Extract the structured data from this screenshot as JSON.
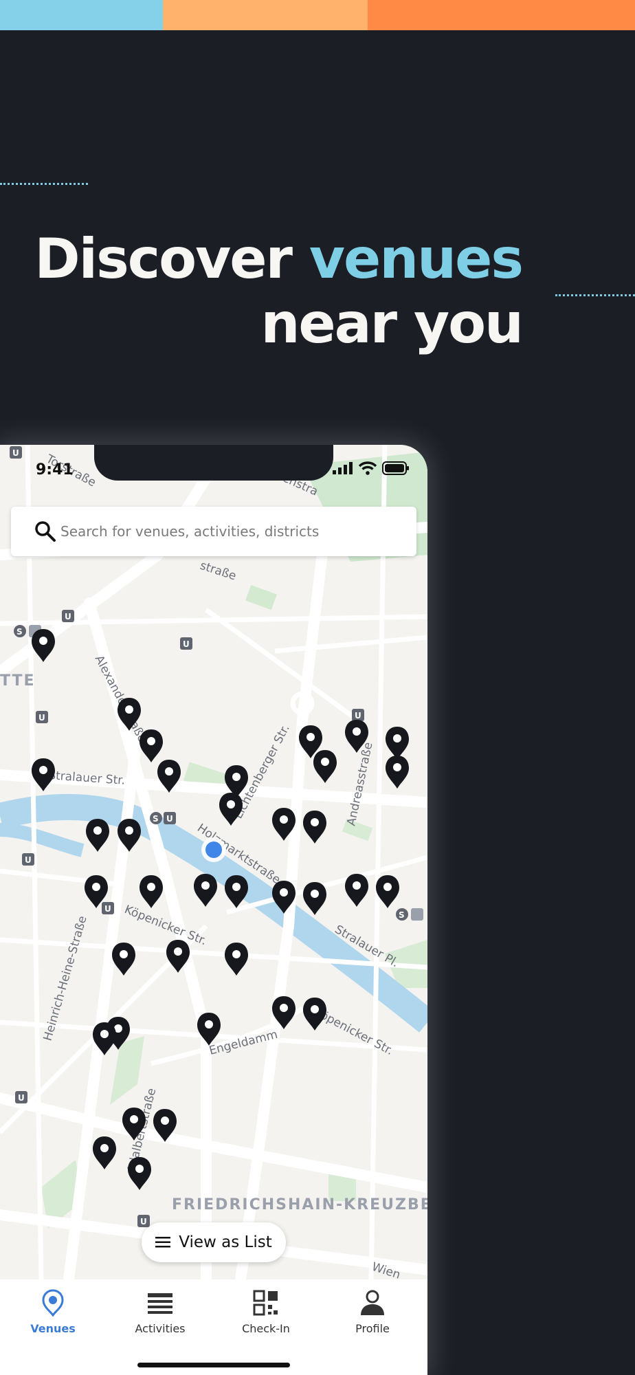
{
  "headline": {
    "line1_part1": "Discover",
    "line1_accent": "venues",
    "line2": "near you"
  },
  "colors": {
    "background": "#1b1e25",
    "accent": "#7ecfe6",
    "stripe_blue": "#86d1ea",
    "stripe_peach": "#ffb26b",
    "stripe_orange": "#ff8a45",
    "active_tab": "#3a7bd5"
  },
  "status_bar": {
    "time": "9:41"
  },
  "search": {
    "placeholder": "Search for venues, activities, districts",
    "icon": "search-icon"
  },
  "map": {
    "streets": [
      "Torstraße",
      "Alexanderstraße",
      "Lichtenberger Str.",
      "Andreasstraße",
      "Holzmarktstraße",
      "Stralauer Str.",
      "Köpenicker Str.",
      "Heinrich-Heine-Straße",
      "Stralauer Pl.",
      "Engeldamm",
      "Köpenicker Str.",
      "Adalbertstraße",
      "Wien",
      "straße",
      "enstra"
    ],
    "districts": [
      "TTE",
      "FRIEDRICHSHAIN-KREUZBE"
    ]
  },
  "list_button": {
    "label": "View as List",
    "icon": "list-icon"
  },
  "tabs": [
    {
      "label": "Venues",
      "icon": "pin-icon",
      "active": true
    },
    {
      "label": "Activities",
      "icon": "activities-icon",
      "active": false
    },
    {
      "label": "Check-In",
      "icon": "qr-icon",
      "active": false
    },
    {
      "label": "Profile",
      "icon": "user-icon",
      "active": false
    }
  ]
}
